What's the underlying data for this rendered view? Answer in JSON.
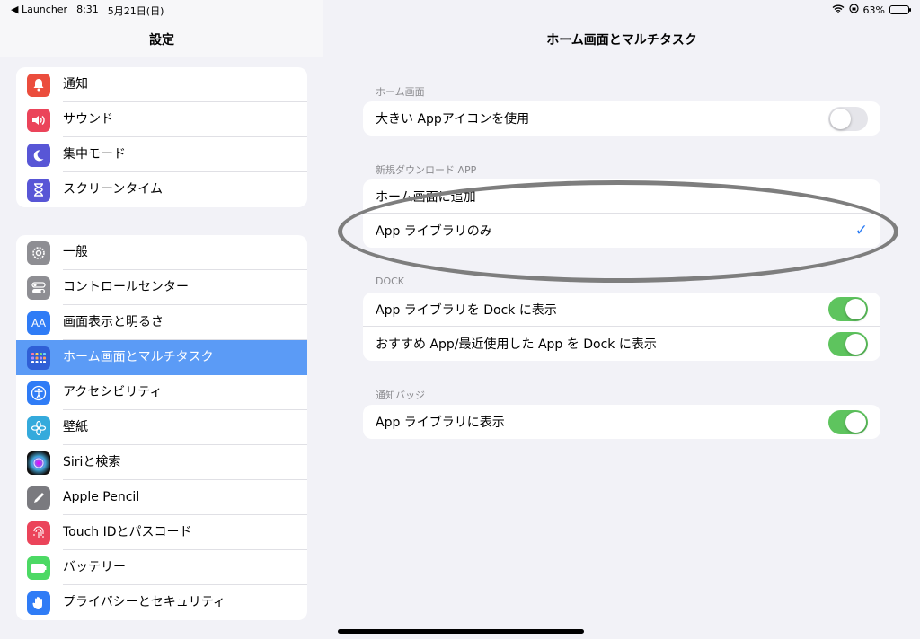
{
  "status_bar": {
    "back_app": "◀ Launcher",
    "time": "8:31",
    "date": "5月21日(日)",
    "battery": "63%",
    "battery_level": 0.63
  },
  "sidebar": {
    "title": "設定",
    "group1": [
      {
        "label": "通知",
        "icon": "bell-icon",
        "color": "#eb4d3d"
      },
      {
        "label": "サウンド",
        "icon": "speaker-icon",
        "color": "#eb445a"
      },
      {
        "label": "集中モード",
        "icon": "moon-icon",
        "color": "#5856d6"
      },
      {
        "label": "スクリーンタイム",
        "icon": "hourglass-icon",
        "color": "#5856d6"
      }
    ],
    "group2": [
      {
        "label": "一般",
        "icon": "gear-icon",
        "color": "#8e8e93"
      },
      {
        "label": "コントロールセンター",
        "icon": "switches-icon",
        "color": "#8e8e93"
      },
      {
        "label": "画面表示と明るさ",
        "icon": "text-size-icon",
        "color": "#2f7cf6"
      },
      {
        "label": "ホーム画面とマルチタスク",
        "icon": "home-grid-icon",
        "color": "#2f5fd6",
        "selected": true
      },
      {
        "label": "アクセシビリティ",
        "icon": "accessibility-icon",
        "color": "#2f7cf6"
      },
      {
        "label": "壁紙",
        "icon": "flower-icon",
        "color": "#34aadc"
      },
      {
        "label": "Siriと検索",
        "icon": "siri-icon",
        "color": "#222222"
      },
      {
        "label": "Apple Pencil",
        "icon": "pencil-icon",
        "color": "#7a7a7f"
      },
      {
        "label": "Touch IDとパスコード",
        "icon": "fingerprint-icon",
        "color": "#eb445a"
      },
      {
        "label": "バッテリー",
        "icon": "battery-icon",
        "color": "#4cd964"
      },
      {
        "label": "プライバシーとセキュリティ",
        "icon": "hand-icon",
        "color": "#2f7cf6"
      }
    ]
  },
  "main": {
    "title": "ホーム画面とマルチタスク",
    "home_screen": {
      "section": "ホーム画面",
      "large_icons": {
        "label": "大きい Appアイコンを使用",
        "on": false
      }
    },
    "new_downloads": {
      "section": "新規ダウンロード APP",
      "add_home": "ホーム画面に追加",
      "library_only": "App ライブラリのみ",
      "selected": "library_only"
    },
    "dock": {
      "section": "DOCK",
      "show_library": {
        "label": "App ライブラリを Dock に表示",
        "on": true
      },
      "show_suggested": {
        "label": "おすすめ App/最近使用した App を Dock に表示",
        "on": true
      }
    },
    "badges": {
      "section": "通知バッジ",
      "show_in_library": {
        "label": "App ライブラリに表示",
        "on": true
      }
    }
  }
}
